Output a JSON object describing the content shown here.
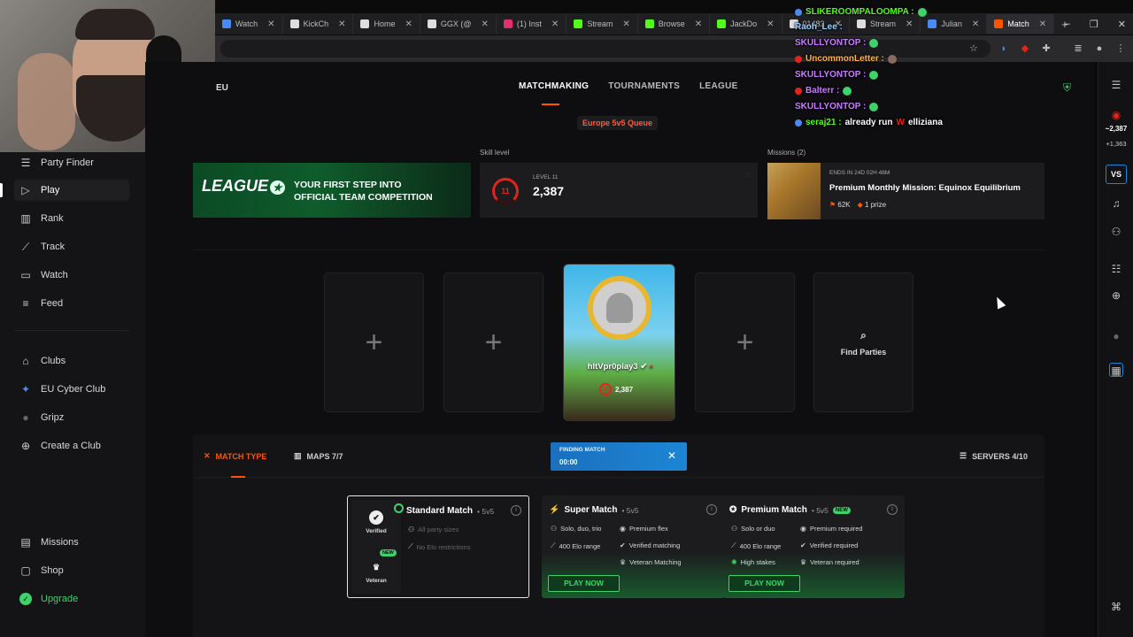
{
  "browser": {
    "tabs": [
      {
        "label": "Watch",
        "color": "#4a8af4"
      },
      {
        "label": "KickCh",
        "color": "#dddddd"
      },
      {
        "label": "Home",
        "color": "#dddddd"
      },
      {
        "label": "GGX (@",
        "color": "#dddddd"
      },
      {
        "label": "(1) Inst",
        "color": "#e1306c"
      },
      {
        "label": "Stream",
        "color": "#53fc18"
      },
      {
        "label": "Browse",
        "color": "#53fc18"
      },
      {
        "label": "JackDo",
        "color": "#53fc18"
      },
      {
        "label": "01483",
        "color": "#dddddd"
      },
      {
        "label": "Stream",
        "color": "#dddddd"
      },
      {
        "label": "Julian",
        "color": "#4a8af4"
      },
      {
        "label": "Match",
        "color": "#ff5500"
      }
    ],
    "new_tab": "+",
    "window_controls": [
      "–",
      "❐",
      "✕"
    ]
  },
  "sidebar": {
    "items": [
      {
        "label": "Party Finder",
        "icon": "party-icon",
        "glyph": "☰"
      },
      {
        "label": "Play",
        "icon": "play-icon",
        "glyph": "▷"
      },
      {
        "label": "Rank",
        "icon": "rank-icon",
        "glyph": "▥"
      },
      {
        "label": "Track",
        "icon": "track-icon",
        "glyph": "⟋"
      },
      {
        "label": "Watch",
        "icon": "watch-icon",
        "glyph": "▭"
      },
      {
        "label": "Feed",
        "icon": "feed-icon",
        "glyph": "≡"
      },
      {
        "label": "Clubs",
        "icon": "clubs-icon",
        "glyph": "⌂"
      },
      {
        "label": "EU Cyber Club",
        "icon": "club-avatar-icon",
        "glyph": "✦"
      },
      {
        "label": "Gripz",
        "icon": "club-avatar-icon",
        "glyph": "●"
      },
      {
        "label": "Create a Club",
        "icon": "plus-circle-icon",
        "glyph": "⊕"
      },
      {
        "label": "Missions",
        "icon": "missions-icon",
        "glyph": "▤"
      },
      {
        "label": "Shop",
        "icon": "shop-icon",
        "glyph": "▢"
      },
      {
        "label": "Upgrade",
        "icon": "upgrade-icon",
        "glyph": "✓"
      }
    ]
  },
  "header": {
    "region": "EU",
    "tabs": [
      "MATCHMAKING",
      "TOURNAMENTS",
      "LEAGUE"
    ],
    "queue": "Europe 5v5 Queue"
  },
  "banner": {
    "logo": "LEAGUE",
    "logo_small": "ESEA",
    "line1": "YOUR FIRST STEP INTO",
    "line2": "OFFICIAL TEAM COMPETITION"
  },
  "skill": {
    "title": "Skill level",
    "level_label": "LEVEL 11",
    "badge": "11",
    "elo": "2,387"
  },
  "missions": {
    "title": "Missions (2)",
    "ends": "ENDS IN 24D 02H 48M",
    "name": "Premium Monthly Mission: Equinox Equilibrium",
    "points": "62K",
    "prize": "1 prize"
  },
  "party": {
    "add": "+",
    "find_label": "Find Parties",
    "player_name": "hltVpr0play3",
    "player_elo": "2,387",
    "player_badge": "11"
  },
  "panel": {
    "match_type": "MATCH TYPE",
    "maps": "MAPS 7/7",
    "servers": "SERVERS 4/10",
    "finding_label": "FINDING MATCH",
    "finding_time": "00:00"
  },
  "cards": {
    "standard": {
      "title": "Standard Match",
      "mode": "• 5v5",
      "opt1": "Verified",
      "opt2": "Veteran",
      "new": "NEW",
      "feat1": "All party sizes",
      "feat2": "No Elo restrictions"
    },
    "super": {
      "title": "Super Match",
      "mode": "• 5v5",
      "feats": [
        "Solo, duo, trio",
        "Premium flex",
        "400 Elo range",
        "Verified matching",
        "Veteran Matching"
      ],
      "button": "PLAY NOW"
    },
    "premium": {
      "title": "Premium Match",
      "mode": "• 5v5",
      "new": "NEW",
      "feats": [
        "Solo or duo",
        "Premium required",
        "400 Elo range",
        "Verified required",
        "High stakes",
        "Veteran required"
      ],
      "button": "PLAY NOW"
    }
  },
  "rail": {
    "stat1": "~2,387",
    "stat2": "+1,363",
    "vs": "VS"
  },
  "chat": [
    {
      "user": "SLIKEROOMPALOOMPA :",
      "msg": "",
      "color": "#53fc18"
    },
    {
      "user": "Raoh_Lee :",
      "msg": "",
      "color": "#9ad0ff"
    },
    {
      "user": "SKULLYONTOP :",
      "msg": "",
      "color": "#c77dff"
    },
    {
      "user": "UncommonLetter :",
      "msg": "",
      "color": "#ffb347"
    },
    {
      "user": "SKULLYONTOP :",
      "msg": "",
      "color": "#c77dff"
    },
    {
      "user": "Balterr :",
      "msg": "",
      "color": "#c77dff"
    },
    {
      "user": "SKULLYONTOP :",
      "msg": "",
      "color": "#c77dff"
    },
    {
      "user": "seraj21 :",
      "msg": "already run",
      "extra": "elliziana",
      "color": "#53fc18"
    }
  ]
}
